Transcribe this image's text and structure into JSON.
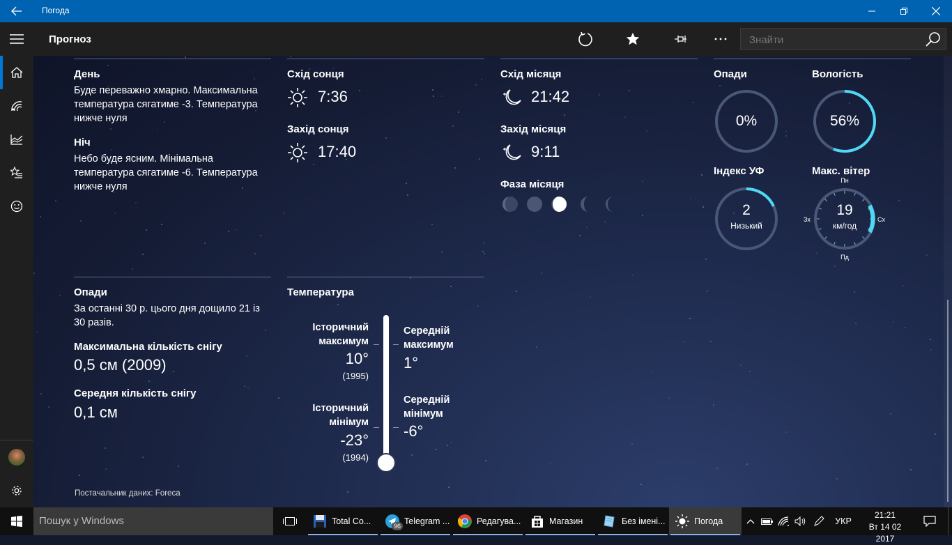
{
  "window": {
    "title": "Погода"
  },
  "appbar": {
    "page_title": "Прогноз",
    "search_placeholder": "Знайти"
  },
  "day_night": {
    "day_label": "День",
    "day_text": [
      "Буде переважно хмарно. Максимальна",
      "температура сягатиме -3. Температура",
      "нижче нуля"
    ],
    "night_label": "Ніч",
    "night_text": [
      "Небо буде ясним. Мінімальна",
      "температура сягатиме -6. Температура",
      "нижче нуля"
    ]
  },
  "sun": {
    "sunrise_label": "Схід сонця",
    "sunrise": "7:36",
    "sunset_label": "Захід сонця",
    "sunset": "17:40"
  },
  "moon": {
    "moonrise_label": "Схід місяця",
    "moonrise": "21:42",
    "moonset_label": "Захід місяця",
    "moonset": "9:11",
    "phase_label": "Фаза місяця"
  },
  "gauges": {
    "precip": {
      "label": "Опади",
      "value": "0%",
      "fraction": 0.0
    },
    "humidity": {
      "label": "Вологість",
      "value": "56%",
      "fraction": 0.56
    },
    "uv": {
      "label": "Індекс УФ",
      "value": "2",
      "sub": "Низький",
      "fraction": 0.18
    },
    "wind": {
      "label": "Макс. вітер",
      "value": "19",
      "unit": "км/год",
      "n": "Пн",
      "e": "Сх",
      "s": "Пд",
      "w": "Зх"
    }
  },
  "history": {
    "precip_label": "Опади",
    "precip_text": [
      "За останні 30 р. цього дня дощило 21 із",
      "30 разів."
    ],
    "max_snow_label": "Максимальна кількість снігу",
    "max_snow": "0,5 см (2009)",
    "avg_snow_label": "Середня кількість снігу",
    "avg_snow": "0,1 см"
  },
  "temperature": {
    "label": "Температура",
    "hist_max_label": [
      "Історичний",
      "максимум"
    ],
    "hist_max": "10°",
    "hist_max_year": "(1995)",
    "avg_max_label": [
      "Середній",
      "максимум"
    ],
    "avg_max": "1°",
    "hist_min_label": [
      "Історичний",
      "мінімум"
    ],
    "hist_min": "-23°",
    "hist_min_year": "(1994)",
    "avg_min_label": [
      "Середній",
      "мінімум"
    ],
    "avg_min": "-6°"
  },
  "provider": "Постачальник даних: Foreca",
  "taskbar": {
    "search_placeholder": "Пошук у Windows",
    "items": [
      "Total Co...",
      "Telegram ...",
      "Редагува...",
      "Магазин",
      "Без імені...",
      "Погода"
    ],
    "telegram_badge": "96",
    "lang": "УКР",
    "time": "21:21",
    "date": "Вт 14 02 2017"
  },
  "colors": {
    "accent": "#0063b1",
    "gauge": "#4fd8f5",
    "nav_select": "#0078d7"
  }
}
